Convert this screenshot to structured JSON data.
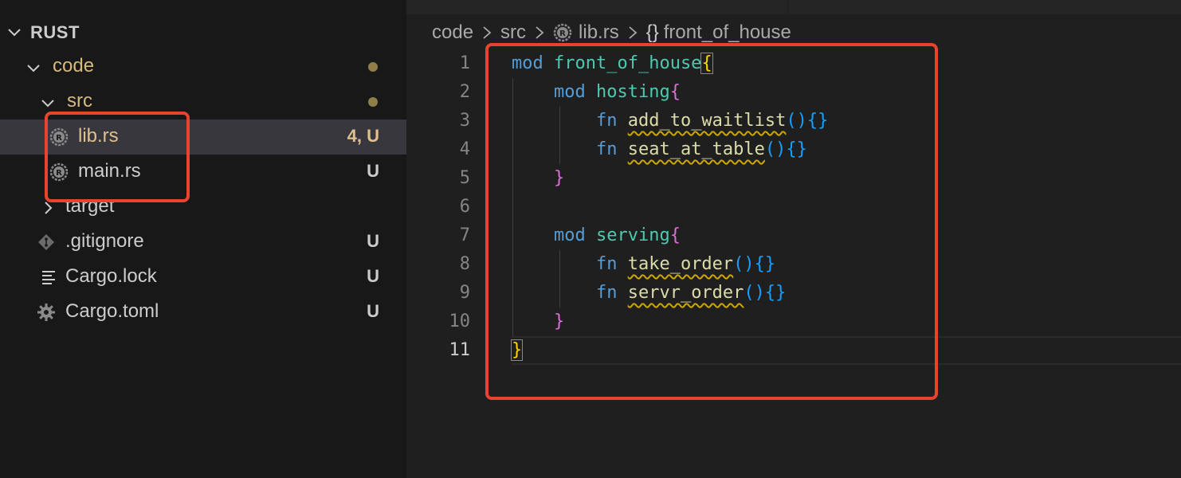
{
  "explorer": {
    "section_title": "RUST",
    "items": [
      {
        "label": "code",
        "badge": "",
        "kind": "folder-open",
        "modified": true
      },
      {
        "label": "src",
        "badge": "",
        "kind": "folder-open",
        "modified": true
      },
      {
        "label": "lib.rs",
        "badge": "4, U",
        "kind": "rust-file",
        "selected": true
      },
      {
        "label": "main.rs",
        "badge": "U",
        "kind": "rust-file"
      },
      {
        "label": "target",
        "badge": "",
        "kind": "folder-closed"
      },
      {
        "label": ".gitignore",
        "badge": "U",
        "kind": "git-file"
      },
      {
        "label": "Cargo.lock",
        "badge": "U",
        "kind": "text-file"
      },
      {
        "label": "Cargo.toml",
        "badge": "U",
        "kind": "gear-file"
      }
    ]
  },
  "breadcrumb": {
    "parts": [
      "code",
      "src",
      "lib.rs",
      "front_of_house"
    ],
    "symbol_icon": "{}"
  },
  "editor": {
    "line_numbers": [
      "1",
      "2",
      "3",
      "4",
      "5",
      "6",
      "7",
      "8",
      "9",
      "10",
      "11"
    ],
    "code": {
      "l1_kw": "mod",
      "l1_name": "front_of_house",
      "l1_brace": "{",
      "l2_kw": "mod",
      "l2_name": "hosting",
      "l2_brace": "{",
      "l3_kw": "fn",
      "l3_name": "add_to_waitlist",
      "l3_parens": "()",
      "l3_braces": "{}",
      "l4_kw": "fn",
      "l4_name": "seat_at_table",
      "l4_parens": "()",
      "l4_braces": "{}",
      "l5_brace": "}",
      "l7_kw": "mod",
      "l7_name": "serving",
      "l7_brace": "{",
      "l8_kw": "fn",
      "l8_name": "take_order",
      "l8_parens": "()",
      "l8_braces": "{}",
      "l9_kw": "fn",
      "l9_name": "servr_order",
      "l9_parens": "()",
      "l9_braces": "{}",
      "l10_brace": "}",
      "l11_brace": "}"
    }
  },
  "colors": {
    "highlight_box": "#e8432e",
    "modified": "#e2c08d",
    "keyword": "#569cd6",
    "module_name": "#4ec9b0",
    "function_name": "#dcdcaa"
  }
}
